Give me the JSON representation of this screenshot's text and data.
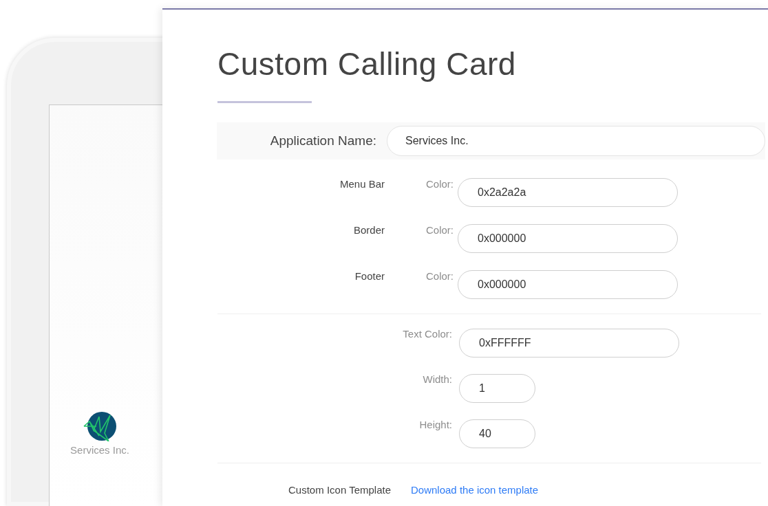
{
  "preview": {
    "app_name": "Services Inc."
  },
  "title": "Custom Calling Card",
  "app_name_field": {
    "label": "Application Name:",
    "value": "Services Inc."
  },
  "color_fields": [
    {
      "section": "Menu Bar",
      "label": "Color:",
      "value": "0x2a2a2a"
    },
    {
      "section": "Border",
      "label": "Color:",
      "value": "0x000000"
    },
    {
      "section": "Footer",
      "label": "Color:",
      "value": "0x000000"
    }
  ],
  "text_fields": [
    {
      "label": "Text Color:",
      "value": "0xFFFFFF",
      "kind": "wide"
    },
    {
      "label": "Width:",
      "value": "1",
      "kind": "narrow"
    },
    {
      "label": "Height:",
      "value": "40",
      "kind": "narrow"
    }
  ],
  "icon_template": {
    "label": "Custom Icon Template",
    "link": "Download the icon template"
  }
}
